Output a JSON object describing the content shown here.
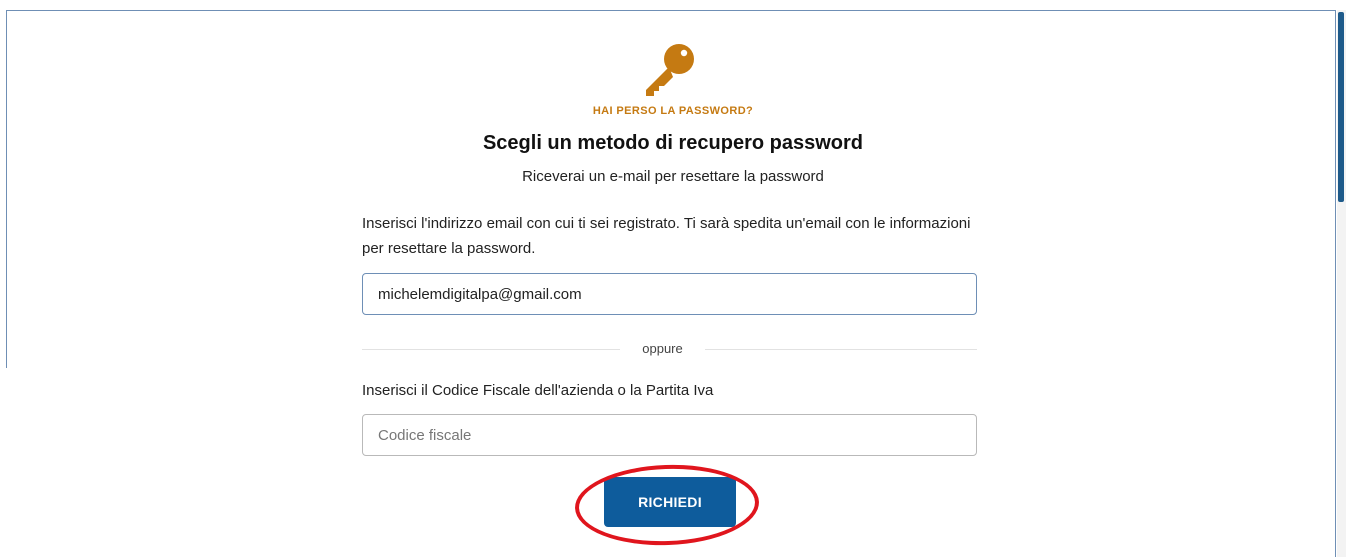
{
  "header": {
    "icon": "key-icon",
    "eyebrow": "HAI PERSO LA PASSWORD?",
    "title": "Scegli un metodo di recupero password",
    "subtitle": "Riceverai un e-mail per resettare la password"
  },
  "email_section": {
    "instructions": "Inserisci l'indirizzo email con cui ti sei registrato. Ti sarà spedita un'email con le informazioni per resettare la password.",
    "email_value": "michelemdigitalpa@gmail.com"
  },
  "divider": {
    "label": "oppure"
  },
  "tax_section": {
    "label": "Inserisci il Codice Fiscale dell'azienda o la Partita Iva",
    "placeholder": "Codice fiscale",
    "value": ""
  },
  "actions": {
    "submit_label": "RICHIEDI"
  },
  "colors": {
    "accent_orange": "#c57a12",
    "primary_blue": "#0e5c9c",
    "highlight_red": "#e0151d"
  }
}
